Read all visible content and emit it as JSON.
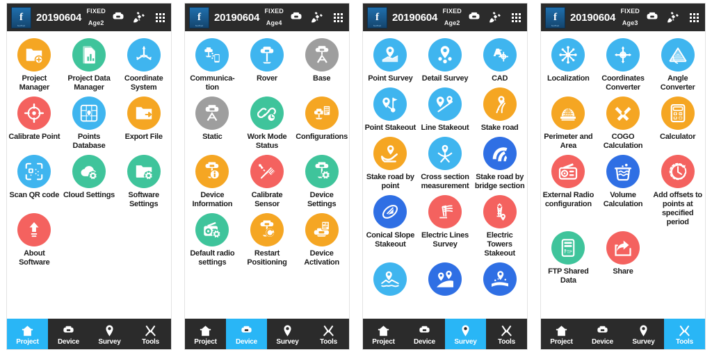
{
  "meta": {
    "app_logo_mark": "f",
    "app_logo_sub": "SurPad",
    "colors": {
      "accent": "#29b6f6",
      "statusbar": "#2b2b2b",
      "orange": "#f5a623",
      "green": "#3fc49b",
      "blue": "#3fb5ef",
      "blue_dark": "#2f6fe4",
      "red": "#f4625f",
      "gray": "#9e9e9e",
      "label": "#1c1c1c"
    }
  },
  "screens": [
    {
      "id": "project",
      "statusbar": {
        "project_name": "20190604",
        "fix_status": "FIXED",
        "age": "Age2",
        "icons": [
          "receiver-icon",
          "satellite-icon",
          "apps-grid-icon"
        ]
      },
      "items": [
        {
          "label": "Project Manager",
          "icon": "folder-add-icon",
          "color": "#f5a623"
        },
        {
          "label": "Project Data Manager",
          "icon": "document-chart-icon",
          "color": "#3fc49b"
        },
        {
          "label": "Coordinate System",
          "icon": "axes-icon",
          "color": "#3fb5ef"
        },
        {
          "label": "Calibrate Point",
          "icon": "crosshair-icon",
          "color": "#f4625f"
        },
        {
          "label": "Points Database",
          "icon": "grid-pin-icon",
          "color": "#3fb5ef"
        },
        {
          "label": "Export File",
          "icon": "folder-export-icon",
          "color": "#f5a623"
        },
        {
          "label": "Scan QR code",
          "icon": "qr-code-icon",
          "color": "#3fb5ef"
        },
        {
          "label": "Cloud Settings",
          "icon": "cloud-gear-icon",
          "color": "#3fc49b"
        },
        {
          "label": "Software Settings",
          "icon": "folder-gear-icon",
          "color": "#3fc49b"
        },
        {
          "label": "About Software",
          "icon": "up-arrow-icon",
          "color": "#f4625f"
        }
      ],
      "nav": [
        {
          "label": "Project",
          "icon": "home-icon",
          "active": true
        },
        {
          "label": "Device",
          "icon": "receiver-icon",
          "active": false
        },
        {
          "label": "Survey",
          "icon": "pin-icon",
          "active": false
        },
        {
          "label": "Tools",
          "icon": "tools-icon",
          "active": false
        }
      ]
    },
    {
      "id": "device",
      "statusbar": {
        "project_name": "20190604",
        "fix_status": "FIXED",
        "age": "Age4",
        "icons": [
          "receiver-icon",
          "satellite-icon",
          "apps-grid-icon"
        ]
      },
      "items": [
        {
          "label": "Communica-tion",
          "icon": "comm-icon",
          "color": "#3fb5ef"
        },
        {
          "label": "Rover",
          "icon": "rover-icon",
          "color": "#3fb5ef"
        },
        {
          "label": "Base",
          "icon": "base-icon",
          "color": "#9e9e9e"
        },
        {
          "label": "Static",
          "icon": "static-icon",
          "color": "#9e9e9e"
        },
        {
          "label": "Work Mode Status",
          "icon": "link-clock-icon",
          "color": "#3fc49b"
        },
        {
          "label": "Configurations",
          "icon": "config-list-icon",
          "color": "#f5a623"
        },
        {
          "label": "Device Information",
          "icon": "device-info-icon",
          "color": "#f5a623"
        },
        {
          "label": "Calibrate Sensor",
          "icon": "calibrate-sensor-icon",
          "color": "#f4625f"
        },
        {
          "label": "Device Settings",
          "icon": "device-gear-icon",
          "color": "#3fc49b"
        },
        {
          "label": "Default radio settings",
          "icon": "radio-gear-icon",
          "color": "#3fc49b"
        },
        {
          "label": "Restart Positioning",
          "icon": "device-restart-icon",
          "color": "#f5a623"
        },
        {
          "label": "Device Activation",
          "icon": "device-activate-icon",
          "color": "#f5a623"
        }
      ],
      "nav": [
        {
          "label": "Project",
          "icon": "home-icon",
          "active": false
        },
        {
          "label": "Device",
          "icon": "receiver-icon",
          "active": true
        },
        {
          "label": "Survey",
          "icon": "pin-icon",
          "active": false
        },
        {
          "label": "Tools",
          "icon": "tools-icon",
          "active": false
        }
      ]
    },
    {
      "id": "survey",
      "statusbar": {
        "project_name": "20190604",
        "fix_status": "FIXED",
        "age": "Age2",
        "icons": [
          "receiver-icon",
          "satellite-icon",
          "apps-grid-icon"
        ]
      },
      "items": [
        {
          "label": "Point Survey",
          "icon": "point-survey-icon",
          "color": "#3fb5ef"
        },
        {
          "label": "Detail Survey",
          "icon": "detail-survey-icon",
          "color": "#3fb5ef"
        },
        {
          "label": "CAD",
          "icon": "cad-icon",
          "color": "#3fb5ef"
        },
        {
          "label": "Point Stakeout",
          "icon": "point-stakeout-icon",
          "color": "#3fb5ef"
        },
        {
          "label": "Line Stakeout",
          "icon": "line-stakeout-icon",
          "color": "#3fb5ef"
        },
        {
          "label": "Stake road",
          "icon": "stake-road-icon",
          "color": "#f5a623"
        },
        {
          "label": "Stake road by point",
          "icon": "stake-road-point-icon",
          "color": "#f5a623"
        },
        {
          "label": "Cross section measurement",
          "icon": "cross-section-icon",
          "color": "#3fb5ef"
        },
        {
          "label": "Stake road by bridge section",
          "icon": "bridge-section-icon",
          "color": "#2f6fe4"
        },
        {
          "label": "Conical Slope Stakeout",
          "icon": "conical-slope-icon",
          "color": "#2f6fe4"
        },
        {
          "label": "Electric Lines Survey",
          "icon": "electric-lines-icon",
          "color": "#f4625f"
        },
        {
          "label": "Electric Towers Stakeout",
          "icon": "electric-tower-icon",
          "color": "#f4625f"
        },
        {
          "label": "",
          "icon": "terrain-survey-icon",
          "color": "#3fb5ef"
        },
        {
          "label": "",
          "icon": "area-survey-icon",
          "color": "#2f6fe4"
        },
        {
          "label": "",
          "icon": "road-pin-icon",
          "color": "#2f6fe4"
        }
      ],
      "nav": [
        {
          "label": "Project",
          "icon": "home-icon",
          "active": false
        },
        {
          "label": "Device",
          "icon": "receiver-icon",
          "active": false
        },
        {
          "label": "Survey",
          "icon": "pin-icon",
          "active": true
        },
        {
          "label": "Tools",
          "icon": "tools-icon",
          "active": false
        }
      ]
    },
    {
      "id": "tools",
      "statusbar": {
        "project_name": "20190604",
        "fix_status": "FIXED",
        "age": "Age3",
        "icons": [
          "receiver-icon",
          "satellite-icon",
          "apps-grid-icon"
        ]
      },
      "items": [
        {
          "label": "Localization",
          "icon": "localization-icon",
          "color": "#3fb5ef"
        },
        {
          "label": "Coordinates Converter",
          "icon": "coord-convert-icon",
          "color": "#3fb5ef"
        },
        {
          "label": "Angle Converter",
          "icon": "angle-convert-icon",
          "color": "#3fb5ef"
        },
        {
          "label": "Perimeter and Area",
          "icon": "perimeter-area-icon",
          "color": "#f5a623"
        },
        {
          "label": "COGO Calculation",
          "icon": "cogo-icon",
          "color": "#f5a623"
        },
        {
          "label": "Calculator",
          "icon": "calculator-icon",
          "color": "#f5a623"
        },
        {
          "label": "External Radio configuration",
          "icon": "radio-icon",
          "color": "#f4625f"
        },
        {
          "label": "Volume Calculation",
          "icon": "volume-calc-icon",
          "color": "#2f6fe4"
        },
        {
          "label": "Add offsets to points at specified period",
          "icon": "offset-clock-icon",
          "color": "#f4625f"
        },
        {
          "label": "FTP Shared Data",
          "icon": "ftp-icon",
          "color": "#3fc49b"
        },
        {
          "label": "Share",
          "icon": "share-icon",
          "color": "#f4625f"
        }
      ],
      "nav": [
        {
          "label": "Project",
          "icon": "home-icon",
          "active": false
        },
        {
          "label": "Device",
          "icon": "receiver-icon",
          "active": false
        },
        {
          "label": "Survey",
          "icon": "pin-icon",
          "active": false
        },
        {
          "label": "Tools",
          "icon": "tools-icon",
          "active": true
        }
      ]
    }
  ]
}
